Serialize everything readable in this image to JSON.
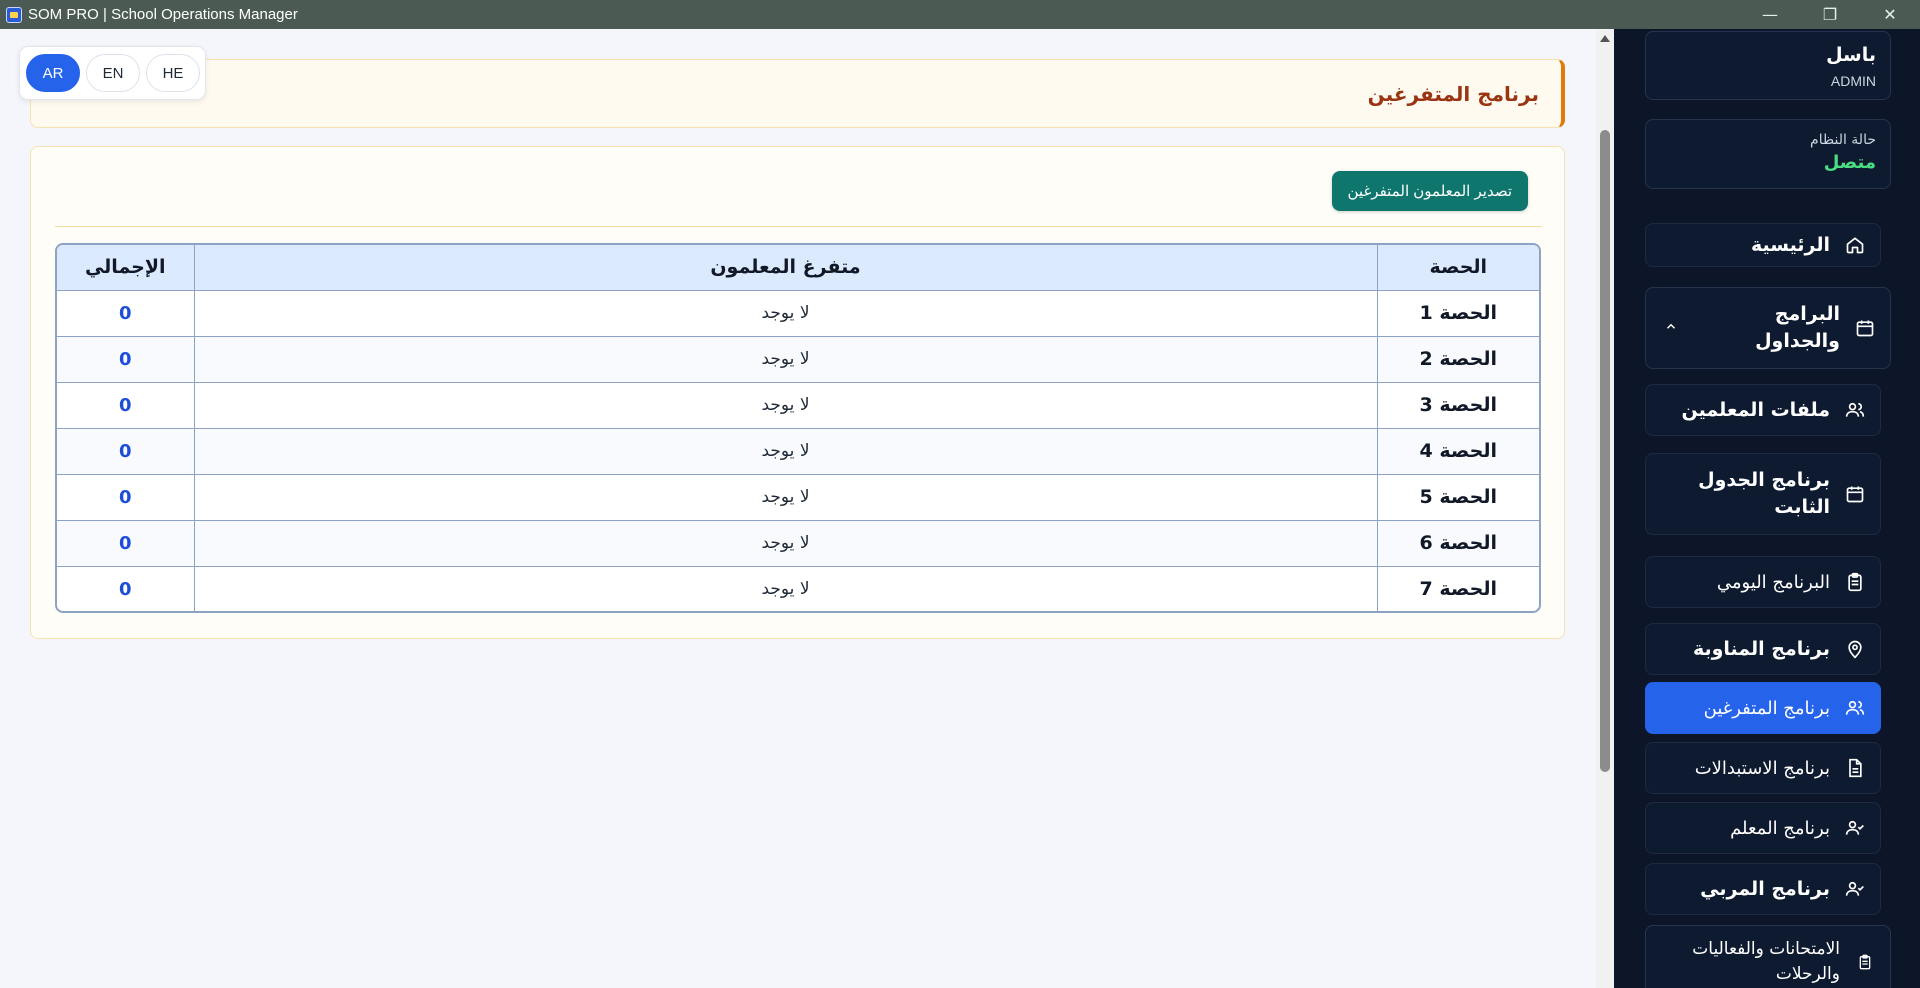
{
  "window": {
    "title": "SOM PRO | School Operations Manager"
  },
  "languages": [
    {
      "code": "AR",
      "active": true
    },
    {
      "code": "EN",
      "active": false
    },
    {
      "code": "HE",
      "active": false
    }
  ],
  "page": {
    "title": "برنامج المتفرغين",
    "export_label": "تصدير المعلمون المتفرغين"
  },
  "table": {
    "headers": {
      "period": "الحصة",
      "free_teachers": "متفرغ المعلمون",
      "total": "الإجمالي"
    },
    "rows": [
      {
        "period": "الحصة 1",
        "free_teachers": "لا يوجد",
        "total": "0"
      },
      {
        "period": "الحصة 2",
        "free_teachers": "لا يوجد",
        "total": "0"
      },
      {
        "period": "الحصة 3",
        "free_teachers": "لا يوجد",
        "total": "0"
      },
      {
        "period": "الحصة 4",
        "free_teachers": "لا يوجد",
        "total": "0"
      },
      {
        "period": "الحصة 5",
        "free_teachers": "لا يوجد",
        "total": "0"
      },
      {
        "period": "الحصة 6",
        "free_teachers": "لا يوجد",
        "total": "0"
      },
      {
        "period": "الحصة 7",
        "free_teachers": "لا يوجد",
        "total": "0"
      }
    ]
  },
  "sidebar": {
    "user": {
      "name": "باسل",
      "role": "ADMIN"
    },
    "status": {
      "label": "حالة النظام",
      "value": "متصل",
      "color": "#4ade80"
    },
    "items": [
      {
        "label": "الرئيسية",
        "icon": "home-icon"
      },
      {
        "label": "البرامج والجداول",
        "icon": "calendar-icon"
      },
      {
        "label": "ملفات المعلمين",
        "icon": "users-icon"
      },
      {
        "label": "برنامج الجدول الثابت",
        "icon": "calendar-icon"
      },
      {
        "label": "البرنامج اليومي",
        "icon": "clipboard-icon"
      },
      {
        "label": "برنامج المناوبة",
        "icon": "map-pin-icon"
      },
      {
        "label": "برنامج المتفرغين",
        "icon": "users-icon",
        "active": true
      },
      {
        "label": "برنامج الاستبدالات",
        "icon": "document-icon"
      },
      {
        "label": "برنامج المعلم",
        "icon": "user-check-icon"
      },
      {
        "label": "برنامج المربي",
        "icon": "user-check-icon"
      },
      {
        "label": "الامتحانات والفعاليات والرحلات",
        "icon": "clipboard-icon"
      }
    ]
  },
  "colors": {
    "accent": "#2563eb",
    "export": "#0f766e",
    "header_border": "#e07b0a",
    "sidebar_bg": "#0c1628"
  }
}
